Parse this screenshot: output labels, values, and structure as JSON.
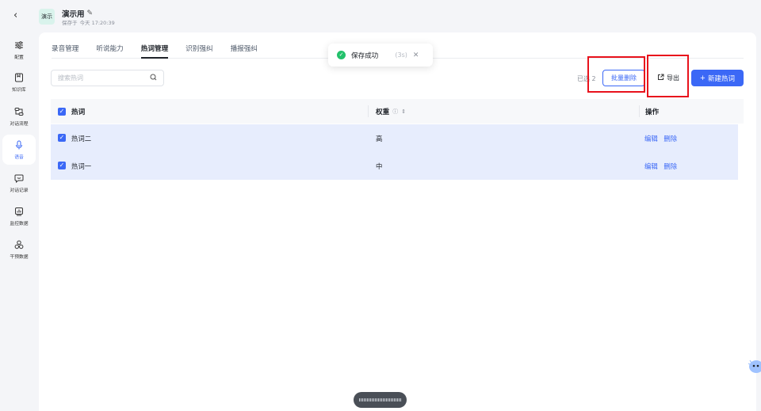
{
  "header": {
    "back_icon": "chevron-left-icon",
    "badge": "演示",
    "app_name": "演示用",
    "edit_icon": "pencil-icon",
    "saved_label": "保存于",
    "saved_time": "今天 17:20:39"
  },
  "sidebar": {
    "items": [
      {
        "label": "配置",
        "icon": "sliders-icon",
        "glyph": "☰"
      },
      {
        "label": "知识库",
        "icon": "book-icon",
        "glyph": "▣"
      },
      {
        "label": "对话流程",
        "icon": "flow-icon",
        "glyph": "⋮"
      },
      {
        "label": "语音",
        "icon": "microphone-icon",
        "glyph": "♪",
        "active": true
      },
      {
        "label": "对话记录",
        "icon": "chat-icon",
        "glyph": "☺"
      },
      {
        "label": "监控数据",
        "icon": "chart-icon",
        "glyph": "▥"
      },
      {
        "label": "干预数据",
        "icon": "nodes-icon",
        "glyph": "∞"
      }
    ],
    "bottom_icon": "settings-file-icon"
  },
  "tabs": [
    {
      "label": "录音管理"
    },
    {
      "label": "听说能力"
    },
    {
      "label": "热词管理",
      "active": true
    },
    {
      "label": "识别强纠"
    },
    {
      "label": "播报强纠"
    }
  ],
  "toolbar": {
    "search_placeholder": "搜索热词",
    "selected_text": "已选 2",
    "batch_delete": "批量删除",
    "export": "导出",
    "new_hotword": "新建热词"
  },
  "table": {
    "columns": [
      "热词",
      "权重",
      "操作"
    ],
    "rows": [
      {
        "word": "热词二",
        "weight": "高",
        "edit": "编辑",
        "delete": "删除"
      },
      {
        "word": "热词一",
        "weight": "中",
        "edit": "编辑",
        "delete": "删除"
      }
    ]
  },
  "toast": {
    "message": "保存成功",
    "countdown": "(3s)"
  },
  "colors": {
    "accent": "#3b68f6",
    "selected_row": "#e7edfd",
    "success": "#23c16b",
    "highlight_box": "#e8121c"
  }
}
